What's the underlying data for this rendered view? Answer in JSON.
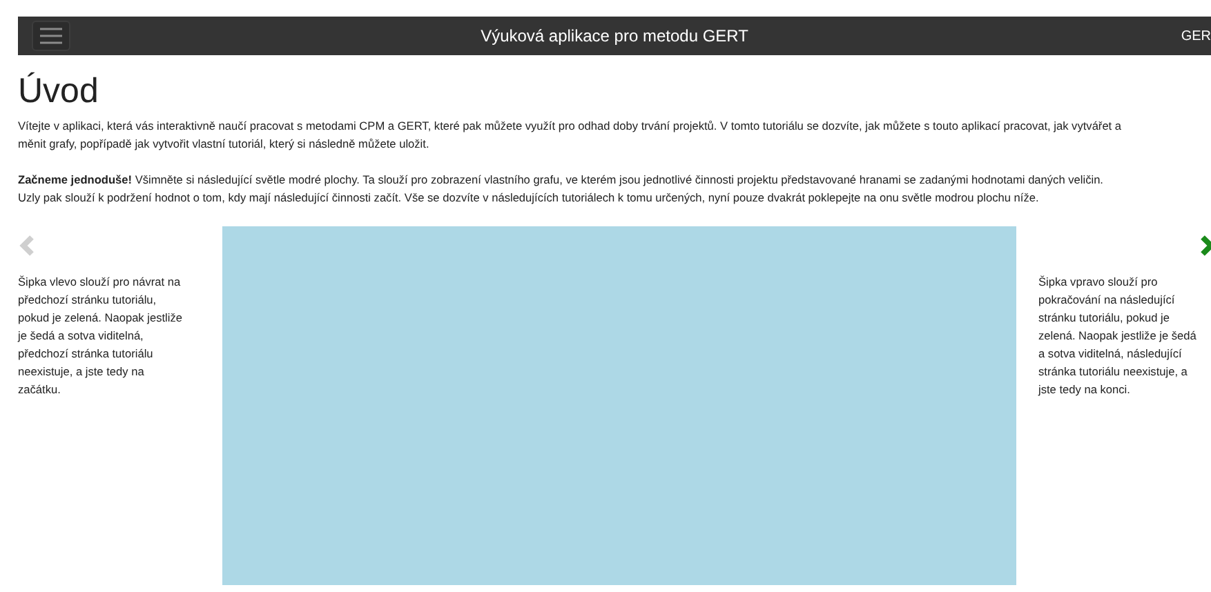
{
  "navbar": {
    "title": "Výuková aplikace pro metodu GERT",
    "right_text": "GER"
  },
  "heading": "Úvod",
  "paragraphs": [
    {
      "lines": [
        "Vítejte v aplikaci, která vás interaktivně naučí pracovat s metodami CPM a GERT, které pak můžete využít pro odhad doby trvání projektů. V tomto tutoriálu se dozvíte, jak můžete s touto aplikací pracovat, jak vytvářet a",
        "měnit grafy, popřípadě jak vytvořit vlastní tutoriál, který si následně můžete uložit."
      ]
    },
    {
      "lines": [
        "**Začneme jednoduše!** Všimněte si následující světle modré plochy. Ta slouží pro zobrazení vlastního grafu, ve kterém jsou jednotlivé činnosti projektu představované hranami se zadanými hodnotami daných veličin.",
        "Uzly pak slouží k podržení hodnot o tom, kdy mají následující činnosti začít. Vše se dozvíte v následujících tutoriálech k tomu určených, nyní pouze dvakrát poklepejte na onu světle modrou plochu níže."
      ]
    }
  ],
  "prev": {
    "enabled": false,
    "lines": [
      "Šipka vlevo slouží pro návrat na",
      "předchozí stránku tutoriálu,",
      "pokud je zelená. Naopak jestliže",
      "je šedá a sotva viditelná,",
      "předchozí stránka tutoriálu",
      "neexistuje, a jste tedy na",
      "začátku."
    ]
  },
  "next": {
    "enabled": true,
    "lines": [
      "Šipka vpravo slouží pro",
      "pokračování na následující",
      "stránku tutoriálu, pokud je",
      "zelená. Naopak jestliže je šedá",
      "a sotva viditelná, následující",
      "stránka tutoriálu neexistuje, a",
      "jste tedy na konci."
    ]
  }
}
